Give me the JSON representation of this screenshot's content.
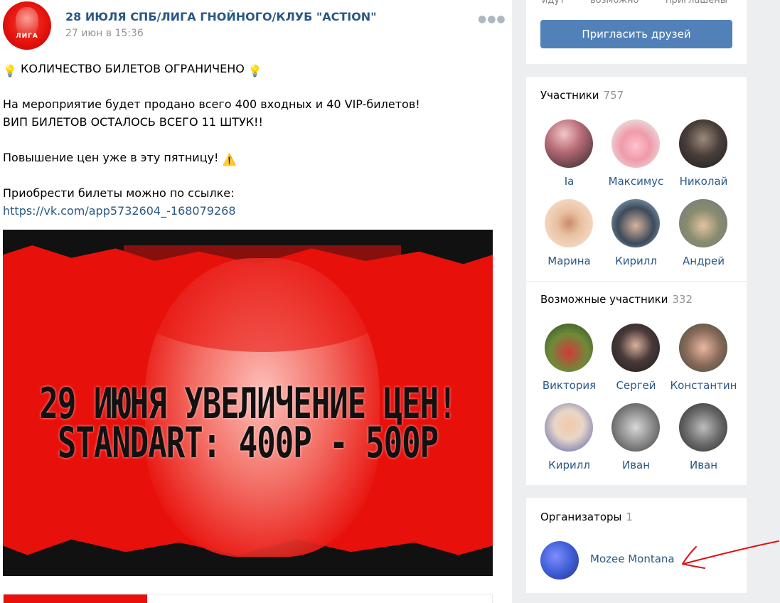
{
  "post": {
    "group_name": "28 ИЮЛЯ СПБ/ЛИГА ГНОЙНОГО/КЛУБ \"ACTION\"",
    "date": "27 июн в 15:36",
    "avatar_text": "ЛИГА",
    "lines": [
      "КОЛИЧЕСТВО БИЛЕТОВ ОГРАНИЧЕНО",
      "На мероприятие будет продано всего 400 входных и 40 VIP-билетов!",
      "ВИП БИЛЕТОВ ОСТАЛОСЬ ВСЕГО 11 ШТУК!!",
      "Повышение цен уже в эту пятницу!",
      "Приобрести билеты можно по ссылке:"
    ],
    "link": "https://vk.com/app5732604_-168079268",
    "poster_line1": "29 ИЮНЯ УВЕЛИЧЕНИЕ ЦЕН!",
    "poster_line2": "STANDART: 400Р - 500Р"
  },
  "sidebar": {
    "stats": [
      "идут",
      "возможно",
      "приглашены"
    ],
    "invite_label": "Пригласить друзей",
    "members": {
      "title": "Участники",
      "count": "757",
      "people": [
        "Ia",
        "Максимус",
        "Николай",
        "Марина",
        "Кирилл",
        "Андрей"
      ]
    },
    "possible": {
      "title": "Возможные участники",
      "count": "332",
      "people": [
        "Виктория",
        "Сергей",
        "Константин",
        "Кирилл",
        "Иван",
        "Иван"
      ]
    },
    "organizers": {
      "title": "Организаторы",
      "count": "1",
      "name": "Mozee Montana"
    }
  },
  "colors": {
    "link": "#2a5885",
    "button": "#5181b8",
    "poster_red": "#e8100b",
    "annotation": "#e01010"
  }
}
